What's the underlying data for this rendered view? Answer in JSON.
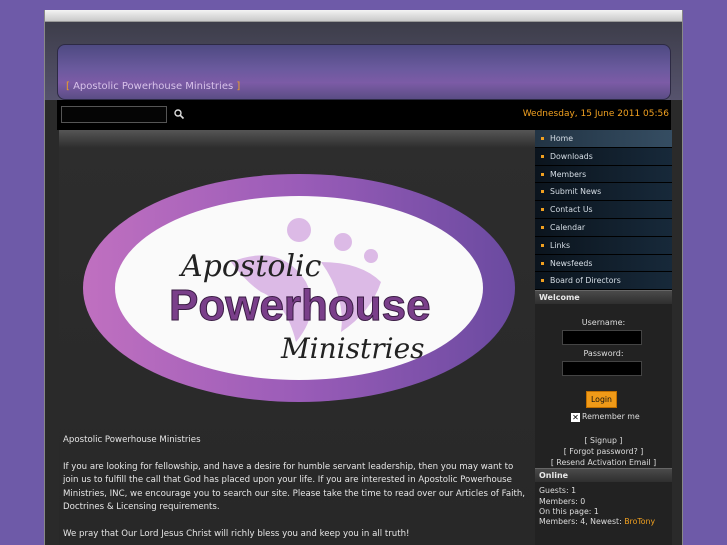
{
  "site": {
    "title": "Apostolic Powerhouse Ministries",
    "bracket_open": "[",
    "bracket_close": "]"
  },
  "topbar": {
    "date": "Wednesday, 15 June 2011 05:56"
  },
  "search": {
    "icon": "search-icon",
    "value": ""
  },
  "logo": {
    "line1": "Apostolic",
    "line2": "Powerhouse",
    "line3": "Ministries"
  },
  "main": {
    "intro_title": "Apostolic Powerhouse Ministries",
    "paragraph1": "If you are looking for fellowship, and have a desire for humble servant leadership, then you may want to join us to fulfill the call that God has placed upon your life. If you are interested in Apostolic Powerhouse Ministries, INC, we encourage you to search our site. Please take the time to read over our Articles of Faith, Doctrines & Licensing requirements.",
    "paragraph2": "We pray that Our Lord Jesus Christ will richly bless you and keep you in all truth!"
  },
  "menu": [
    {
      "label": "Home"
    },
    {
      "label": "Downloads"
    },
    {
      "label": "Members"
    },
    {
      "label": "Submit News"
    },
    {
      "label": "Contact Us"
    },
    {
      "label": "Calendar"
    },
    {
      "label": "Links"
    },
    {
      "label": "Newsfeeds"
    },
    {
      "label": "Board of Directors"
    }
  ],
  "welcome": {
    "title": "Welcome",
    "username_label": "Username:",
    "password_label": "Password:",
    "login_label": "Login",
    "remember_label": "Remember me",
    "signup": "[ Signup ]",
    "forgot": "[ Forgot password? ]",
    "resend": "[ Resend Activation Email ]"
  },
  "online": {
    "title": "Online",
    "guests": "Guests: 1",
    "members": "Members: 0",
    "on_this_page": "On this page: 1",
    "members_newest_prefix": "Members: 4, Newest: ",
    "newest_member": "BroTony"
  },
  "colors": {
    "background": "#6e5aa8",
    "accent": "#f0a020",
    "logo_purple": "#9a6bb8"
  }
}
